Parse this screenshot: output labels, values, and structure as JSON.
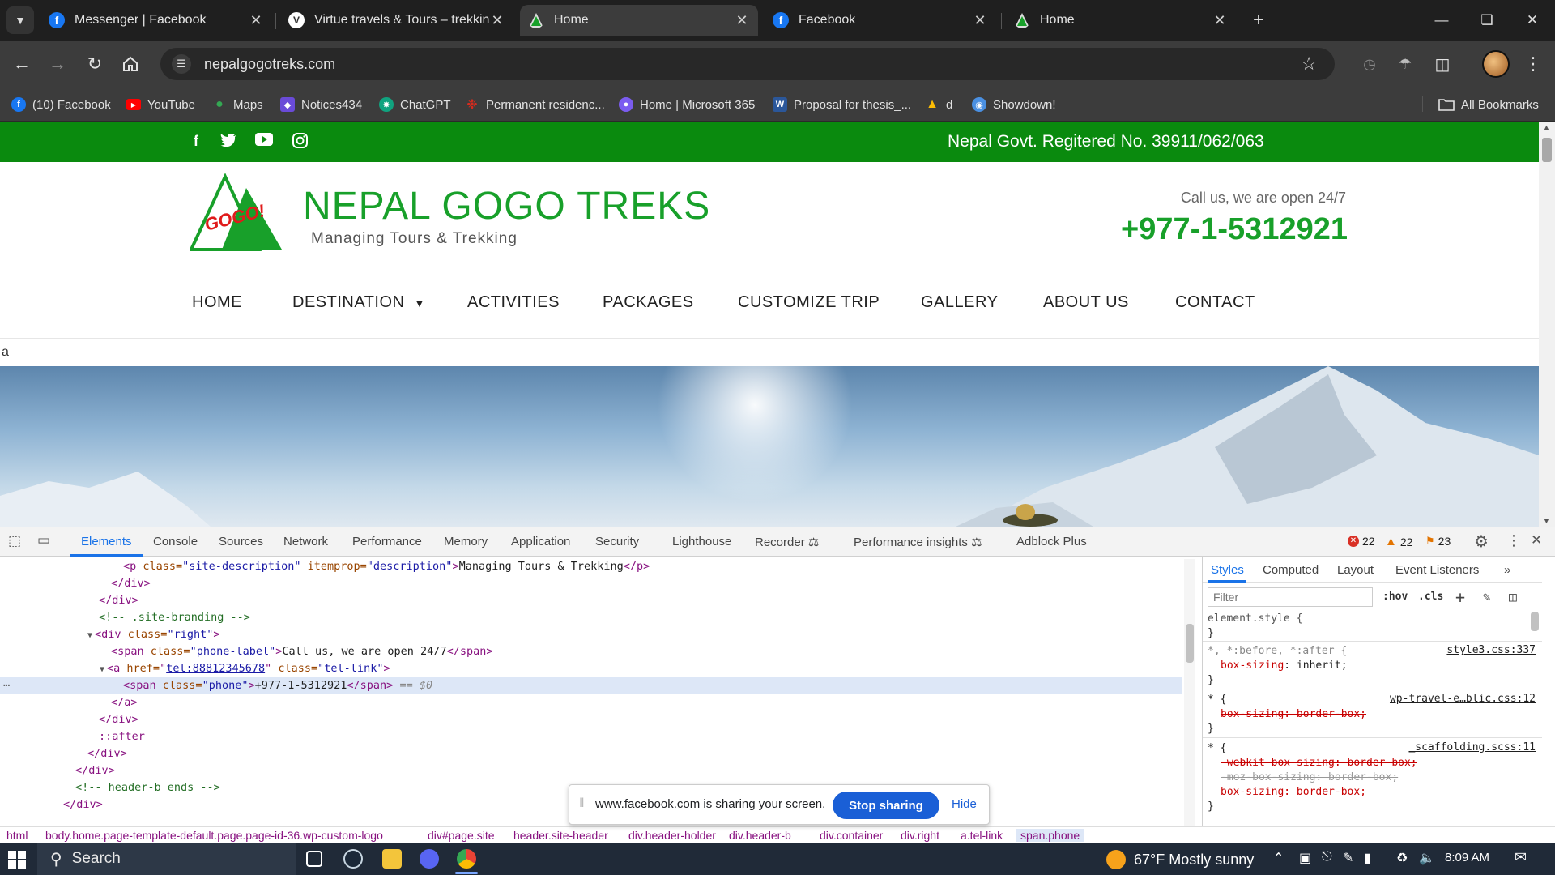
{
  "browser": {
    "tabs": [
      {
        "title": "Messenger | Facebook",
        "icon": "facebook-icon",
        "active": false
      },
      {
        "title": "Virtue travels & Tours – trekking",
        "icon": "virtue-icon",
        "active": false
      },
      {
        "title": "Home",
        "icon": "gogo-triangle-icon",
        "active": true
      },
      {
        "title": "Facebook",
        "icon": "facebook-icon",
        "active": false
      },
      {
        "title": "Home",
        "icon": "gogo-triangle-icon",
        "active": false
      }
    ],
    "url": "nepalgogotreks.com",
    "bookmarks": [
      {
        "label": "(10) Facebook",
        "icon": "facebook-icon",
        "color": "#1877f2"
      },
      {
        "label": "YouTube",
        "icon": "youtube-icon",
        "color": "#ff0000"
      },
      {
        "label": "Maps",
        "icon": "maps-icon",
        "color": "#34a853"
      },
      {
        "label": "Notices434",
        "icon": "notices-icon",
        "color": "#6a4bd8"
      },
      {
        "label": "ChatGPT",
        "icon": "chatgpt-icon",
        "color": "#10a37f"
      },
      {
        "label": "Permanent residenc...",
        "icon": "maple-leaf-icon",
        "color": "#d52b1e"
      },
      {
        "label": "Home | Microsoft 365",
        "icon": "m365-icon",
        "color": "#7b5cf0"
      },
      {
        "label": "Proposal for thesis_...",
        "icon": "word-icon",
        "color": "#2b579a"
      },
      {
        "label": "d",
        "icon": "drive-icon",
        "color": "#fbbc04"
      },
      {
        "label": "Showdown!",
        "icon": "showdown-icon",
        "color": "#4a90e2"
      }
    ],
    "all_bookmarks": "All Bookmarks"
  },
  "site": {
    "registration": "Nepal Govt. Regitered No. 39911/062/063",
    "logo_text": "GOGO!",
    "brand_name": "NEPAL GOGO TREKS",
    "tagline": "Managing Tours & Trekking",
    "call_label": "Call us, we are open 24/7",
    "phone": "+977-1-5312921",
    "menu": [
      "HOME",
      "DESTINATION",
      "ACTIVITIES",
      "PACKAGES",
      "CUSTOMIZE TRIP",
      "GALLERY",
      "ABOUT US",
      "CONTACT"
    ],
    "stray_text": "a",
    "colors": {
      "brand_green": "#18a02a",
      "topbar_green": "#0a8a0e"
    }
  },
  "devtools": {
    "tabs": [
      "Elements",
      "Console",
      "Sources",
      "Network",
      "Performance",
      "Memory",
      "Application",
      "Security",
      "Lighthouse",
      "Recorder",
      "Performance insights",
      "Adblock Plus"
    ],
    "errors": "22",
    "warnings": "22",
    "issues": "23",
    "dom_lines": {
      "l1_tag_open": "<p ",
      "l1_attr1": "class=",
      "l1_val1": "\"site-description\"",
      "l1_attr2": " itemprop=",
      "l1_val2": "\"description\"",
      "l1_text": "Managing Tours & Trekking",
      "l1_close": "</p>",
      "l2": "</div>",
      "l3": "</div>",
      "l4": "<!-- .site-branding -->",
      "l5_open": "<div ",
      "l5_attr": "class=",
      "l5_val": "\"right\"",
      "l6_open": "<span ",
      "l6_attr": "class=",
      "l6_val": "\"phone-label\"",
      "l6_text": "Call us, we are open 24/7",
      "l6_close": "</span>",
      "l7_open": "<a ",
      "l7_attr1": "href=",
      "l7_val1": "tel:88812345678",
      "l7_attr2": " class=",
      "l7_val2": "\"tel-link\"",
      "l8_open": "<span ",
      "l8_attr": "class=",
      "l8_val": "\"phone\"",
      "l8_text": "+977-1-5312921",
      "l8_close": "</span>",
      "l8_dollar": " == $0",
      "l9": "</a>",
      "l10": "</div>",
      "l11": "::after",
      "l12": "</div>",
      "l13": "</div>",
      "l14": "<!-- header-b ends -->",
      "l15": "</div>"
    },
    "styles_tabs": [
      "Styles",
      "Computed",
      "Layout",
      "Event Listeners"
    ],
    "filter_placeholder": "Filter",
    "hov": ":hov",
    "cls": ".cls",
    "rules": {
      "r1_sel": "element.style {",
      "r1_end": "}",
      "r2_sel": "*, *:before, *:after {",
      "r2_src": "style3.css:337",
      "r2_prop": "box-sizing",
      "r2_val": ": inherit;",
      "r2_end": "}",
      "r3_sel": "* {",
      "r3_src": "wp-travel-e…blic.css:12",
      "r3_prop": "box-sizing: border-box;",
      "r3_end": "}",
      "r4_sel": "* {",
      "r4_src": "_scaffolding.scss:11",
      "r4_p1": "-webkit-box-sizing: border-box;",
      "r4_p2": "-moz-box-sizing: border-box;",
      "r4_p3": "box-sizing: border-box;",
      "r4_end": "}"
    },
    "breadcrumbs": [
      "html",
      "body.home.page-template-default.page.page-id-36.wp-custom-logo",
      "div#page.site",
      "header.site-header",
      "div.header-holder",
      "div.header-b",
      "div.container",
      "div.right",
      "a.tel-link",
      "span.phone"
    ]
  },
  "share_banner": {
    "text": "www.facebook.com is sharing your screen.",
    "stop": "Stop sharing",
    "hide": "Hide"
  },
  "taskbar": {
    "search": "Search",
    "weather": "67°F  Mostly sunny",
    "time": "8:09 AM"
  }
}
